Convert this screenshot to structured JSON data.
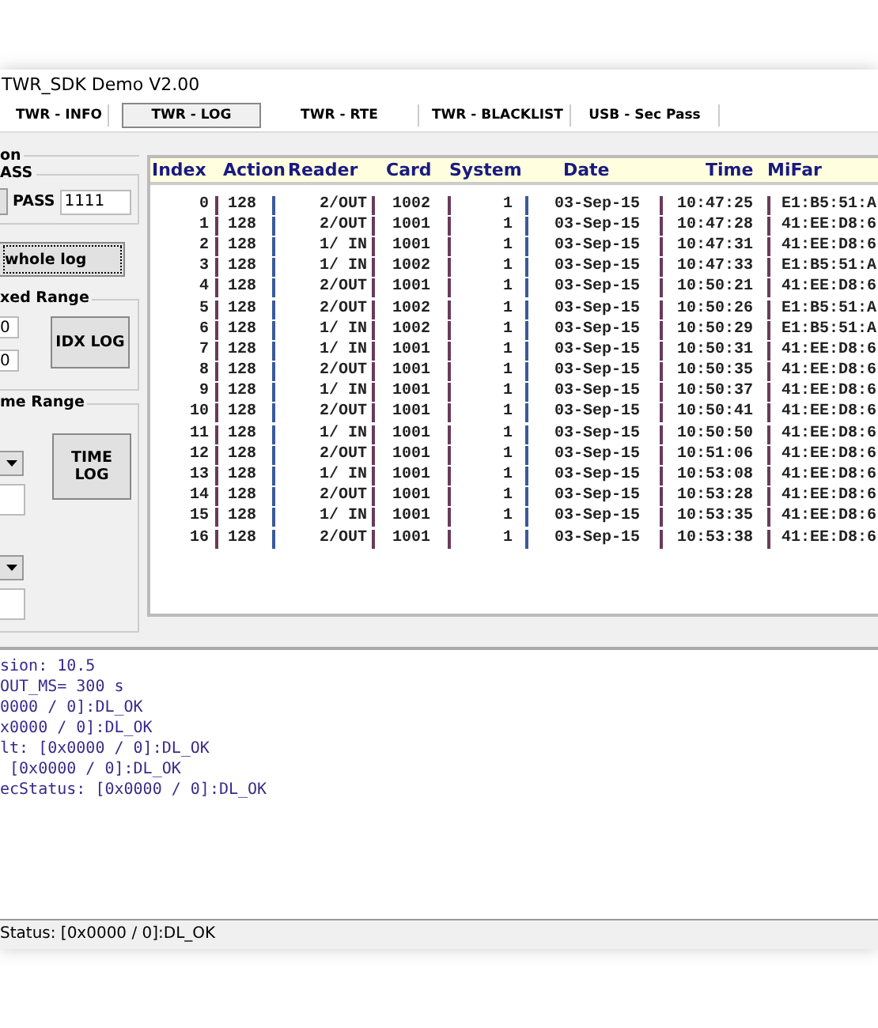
{
  "window": {
    "title": "TWR_SDK Demo V2.00"
  },
  "tabs": [
    {
      "label": "TWR - INFO",
      "selected": false
    },
    {
      "label": "TWR - LOG",
      "selected": true
    },
    {
      "label": "TWR - RTE",
      "selected": false
    },
    {
      "label": "TWR - BLACKLIST",
      "selected": false
    },
    {
      "label": "USB - Sec Pass",
      "selected": false
    }
  ],
  "left_panel": {
    "group_title": "on",
    "pass_group": {
      "title": "ASS",
      "label": "PASS",
      "value": "1111"
    },
    "whole_log_button": "whole log",
    "index_range": {
      "title": "xed Range",
      "from": "0",
      "to": "0",
      "button": "IDX LOG"
    },
    "time_range": {
      "title": "me Range",
      "button": "TIME LOG"
    }
  },
  "table": {
    "columns": [
      "Index",
      "Action",
      "Reader",
      "Card",
      "System",
      "Date",
      "Time",
      "MiFar"
    ],
    "rows": [
      [
        "0",
        "128",
        "2/OUT",
        "1002",
        "1",
        "03-Sep-15",
        "10:47:25",
        "E1:B5:51:A"
      ],
      [
        "1",
        "128",
        "2/OUT",
        "1001",
        "1",
        "03-Sep-15",
        "10:47:28",
        "41:EE:D8:6"
      ],
      [
        "2",
        "128",
        "1/ IN",
        "1001",
        "1",
        "03-Sep-15",
        "10:47:31",
        "41:EE:D8:6"
      ],
      [
        "3",
        "128",
        "1/ IN",
        "1002",
        "1",
        "03-Sep-15",
        "10:47:33",
        "E1:B5:51:A"
      ],
      [
        "4",
        "128",
        "2/OUT",
        "1001",
        "1",
        "03-Sep-15",
        "10:50:21",
        "41:EE:D8:6"
      ],
      [
        "5",
        "128",
        "2/OUT",
        "1002",
        "1",
        "03-Sep-15",
        "10:50:26",
        "E1:B5:51:A"
      ],
      [
        "6",
        "128",
        "1/ IN",
        "1002",
        "1",
        "03-Sep-15",
        "10:50:29",
        "E1:B5:51:A"
      ],
      [
        "7",
        "128",
        "1/ IN",
        "1001",
        "1",
        "03-Sep-15",
        "10:50:31",
        "41:EE:D8:6"
      ],
      [
        "8",
        "128",
        "2/OUT",
        "1001",
        "1",
        "03-Sep-15",
        "10:50:35",
        "41:EE:D8:6"
      ],
      [
        "9",
        "128",
        "1/ IN",
        "1001",
        "1",
        "03-Sep-15",
        "10:50:37",
        "41:EE:D8:6"
      ],
      [
        "10",
        "128",
        "2/OUT",
        "1001",
        "1",
        "03-Sep-15",
        "10:50:41",
        "41:EE:D8:6"
      ],
      [
        "11",
        "128",
        "1/ IN",
        "1001",
        "1",
        "03-Sep-15",
        "10:50:50",
        "41:EE:D8:6"
      ],
      [
        "12",
        "128",
        "2/OUT",
        "1001",
        "1",
        "03-Sep-15",
        "10:51:06",
        "41:EE:D8:6"
      ],
      [
        "13",
        "128",
        "1/ IN",
        "1001",
        "1",
        "03-Sep-15",
        "10:53:08",
        "41:EE:D8:6"
      ],
      [
        "14",
        "128",
        "2/OUT",
        "1001",
        "1",
        "03-Sep-15",
        "10:53:28",
        "41:EE:D8:6"
      ],
      [
        "15",
        "128",
        "1/ IN",
        "1001",
        "1",
        "03-Sep-15",
        "10:53:35",
        "41:EE:D8:6"
      ],
      [
        "16",
        "128",
        "2/OUT",
        "1001",
        "1",
        "03-Sep-15",
        "10:53:38",
        "41:EE:D8:6"
      ]
    ]
  },
  "log": [
    "sion: 10.5",
    "OUT_MS= 300 s",
    "0000 / 0]:DL_OK",
    "x0000 / 0]:DL_OK",
    "lt: [0x0000 / 0]:DL_OK",
    " [0x0000 / 0]:DL_OK",
    "ecStatus: [0x0000 / 0]:DL_OK"
  ],
  "status_bar": "Status: [0x0000 / 0]:DL_OK"
}
